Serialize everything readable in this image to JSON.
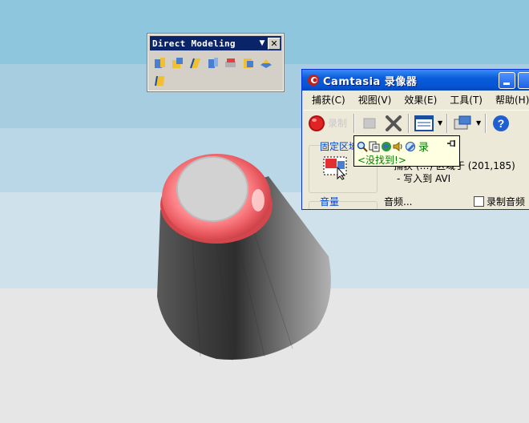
{
  "colors": {
    "sky_top": "#8ec6dd",
    "floor": "#e6e6e6",
    "knob_red": "#e8585e",
    "cone_gray": "#6e6e6e",
    "xp_titlebar_blue": "#0554d4",
    "classic_titlebar_blue": "#0a246a",
    "tooltip_bg": "#ffffe1",
    "link_blue": "#0046d5"
  },
  "direct_modeling": {
    "title": "Direct Modeling",
    "dropdown_icon": "triangle-down-icon",
    "close_label": "✕",
    "tools": [
      "move-face-icon",
      "offset-face-icon",
      "rotate-face-icon",
      "replace-face-icon",
      "delete-face-icon",
      "pattern-face-icon",
      "resize-face-icon",
      "draft-face-icon"
    ]
  },
  "camtasia": {
    "title": "Camtasia 录像器",
    "menu": [
      "捕获(C)",
      "视图(V)",
      "效果(E)",
      "工具(T)",
      "帮助(H)"
    ],
    "toolbar": {
      "record_label": "录制",
      "record_icon": "record-circle-icon",
      "stop_icon": "stop-square-icon",
      "delete_icon": "delete-x-icon",
      "region_icon": "capture-region-icon",
      "output_icon": "output-settings-icon",
      "help_label": "?"
    },
    "fixed_region_label": "固定区域",
    "capture_text": "捕获 (…) 区域于 (201,185)",
    "write_to": "- 写入到 AVI",
    "volume_label": "音量",
    "audio_label": "音频...",
    "record_audio_label": "录制音频",
    "record_audio_checked": false
  },
  "tooltip": {
    "icons": [
      "search-icon",
      "copy-icon",
      "web-icon",
      "audio-icon",
      "edit-icon"
    ],
    "record_label": "录",
    "pin_icon": "pin-icon",
    "not_found": "<没找到!>"
  }
}
